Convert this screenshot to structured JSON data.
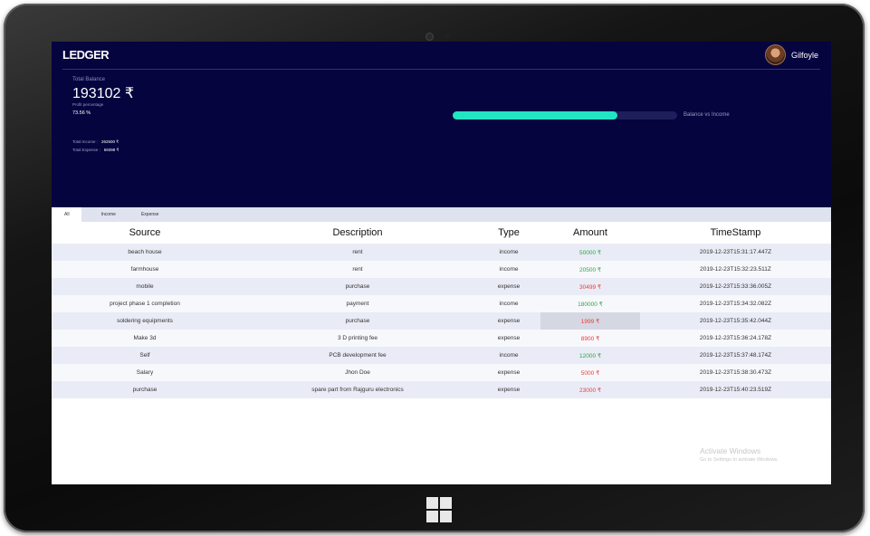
{
  "app": {
    "brand": "LEDGER",
    "user_name": "Gilfoyle"
  },
  "summary": {
    "total_balance_label": "Total Balance",
    "total_balance_value": "193102 ₹",
    "profit_label": "Profit percentage",
    "profit_value": "73.56 %",
    "total_income_label": "Total Income :",
    "total_income_value": "262500 ₹",
    "total_expense_label": "Total Expense :",
    "total_expense_value": "69398 ₹",
    "progress_label": "Balance vs Income",
    "progress_fraction": 0.7356,
    "progress_color": "#22e5c4"
  },
  "tabs": [
    {
      "label": "All",
      "active": true
    },
    {
      "label": "Income",
      "active": false
    },
    {
      "label": "Expense",
      "active": false
    }
  ],
  "table": {
    "headers": [
      "Source",
      "Description",
      "Type",
      "Amount",
      "TimeStamp"
    ],
    "rows": [
      {
        "source": "beach house",
        "description": "rent",
        "type": "income",
        "amount": "50000 ₹",
        "timestamp": "2019-12-23T15:31:17.447Z"
      },
      {
        "source": "farmhouse",
        "description": "rent",
        "type": "income",
        "amount": "20500 ₹",
        "timestamp": "2019-12-23T15:32:23.511Z"
      },
      {
        "source": "mobile",
        "description": "purchase",
        "type": "expense",
        "amount": "30499 ₹",
        "timestamp": "2019-12-23T15:33:36.005Z"
      },
      {
        "source": "project phase 1 completion",
        "description": "payment",
        "type": "income",
        "amount": "180000 ₹",
        "timestamp": "2019-12-23T15:34:32.082Z"
      },
      {
        "source": "soldering equipments",
        "description": "purchase",
        "type": "expense",
        "amount": "1999 ₹",
        "timestamp": "2019-12-23T15:35:42.044Z"
      },
      {
        "source": "Make 3d",
        "description": "3 D printing fee",
        "type": "expense",
        "amount": "8900 ₹",
        "timestamp": "2019-12-23T15:36:24.178Z"
      },
      {
        "source": "Self",
        "description": "PCB development fee",
        "type": "income",
        "amount": "12000 ₹",
        "timestamp": "2019-12-23T15:37:48.174Z"
      },
      {
        "source": "Salary",
        "description": "Jhon Doe",
        "type": "expense",
        "amount": "5000 ₹",
        "timestamp": "2019-12-23T15:38:30.473Z"
      },
      {
        "source": "purchase",
        "description": "spare part from Rajguru electronics",
        "type": "expense",
        "amount": "23000 ₹",
        "timestamp": "2019-12-23T15:40:23.519Z"
      }
    ],
    "highlighted_row": 4
  },
  "watermark": {
    "title": "Activate Windows",
    "subtitle": "Go to Settings to activate Windows."
  },
  "colors": {
    "header_bg": "#05043f",
    "income": "#2aa845",
    "expense": "#ee3a3a"
  }
}
